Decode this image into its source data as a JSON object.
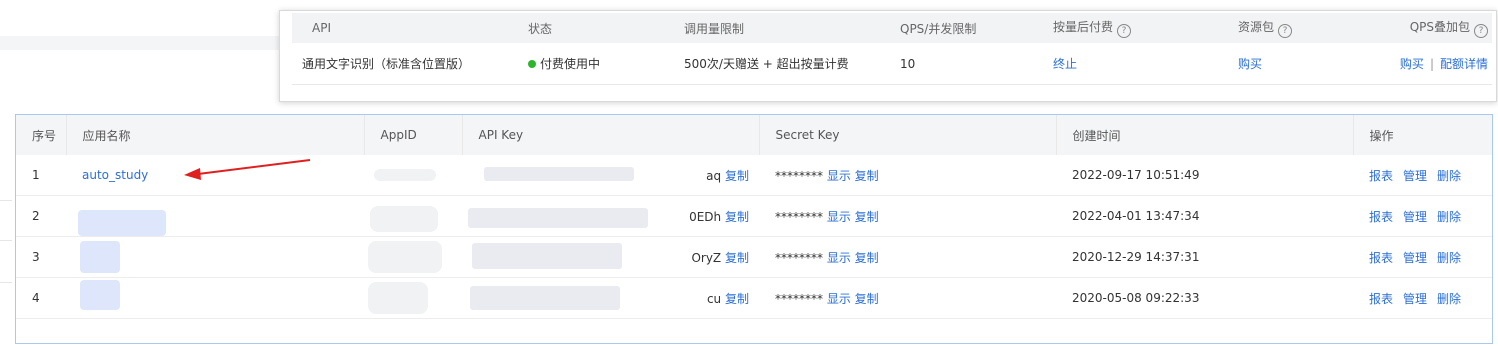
{
  "api_table": {
    "headers": {
      "api": "API",
      "status": "状态",
      "quota": "调用量限制",
      "qps": "QPS/并发限制",
      "postpay": "按量后付费",
      "package": "资源包",
      "qps_addon": "QPS叠加包"
    },
    "help_glyph": "?",
    "row": {
      "api": "通用文字识别（标准含位置版）",
      "status": "付费使用中",
      "status_color": "#2db52d",
      "quota": "500次/天赠送 + 超出按量计费",
      "qps": "10",
      "postpay_action": "终止",
      "package_action": "购买",
      "addon_buy": "购买",
      "addon_sep": "|",
      "addon_detail": "配额详情"
    }
  },
  "app_table": {
    "headers": {
      "index": "序号",
      "name": "应用名称",
      "appid": "AppID",
      "apikey": "API Key",
      "secret": "Secret Key",
      "created": "创建时间",
      "ops": "操作"
    },
    "rows": [
      {
        "index": "1",
        "name": "auto_study",
        "apikey_tail": "aq",
        "copy": "复制",
        "secret_mask": "********",
        "show": "显示",
        "copy2": "复制",
        "created": "2022-09-17 10:51:49",
        "op_report": "报表",
        "op_manage": "管理",
        "op_delete": "删除"
      },
      {
        "index": "2",
        "name": "",
        "apikey_tail": "0EDh",
        "copy": "复制",
        "secret_mask": "********",
        "show": "显示",
        "copy2": "复制",
        "created": "2022-04-01 13:47:34",
        "op_report": "报表",
        "op_manage": "管理",
        "op_delete": "删除"
      },
      {
        "index": "3",
        "name": "",
        "apikey_tail": "OryZ",
        "copy": "复制",
        "secret_mask": "********",
        "show": "显示",
        "copy2": "复制",
        "created": "2020-12-29 14:37:31",
        "op_report": "报表",
        "op_manage": "管理",
        "op_delete": "删除"
      },
      {
        "index": "4",
        "name": "",
        "apikey_tail": "cu",
        "copy": "复制",
        "secret_mask": "********",
        "show": "显示",
        "copy2": "复制",
        "created": "2020-05-08 09:22:33",
        "op_report": "报表",
        "op_manage": "管理",
        "op_delete": "删除"
      }
    ]
  },
  "colors": {
    "link": "#2b6fd6",
    "arrow": "#e02020",
    "panel_border": "#a9c9ee"
  }
}
